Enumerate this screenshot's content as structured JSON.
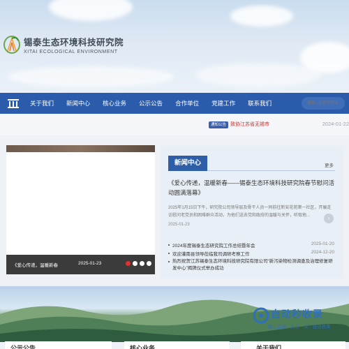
{
  "header": {
    "org_name_cn": "锡泰生态环境科技研究院",
    "org_name_en": "XITAI ECOLOGICAL ENVIRONMENT",
    "logo_icon": "leaf-logo-icon"
  },
  "nav": {
    "home_icon": "home-icon",
    "items": [
      {
        "label": "关于我们"
      },
      {
        "label": "新闻中心"
      },
      {
        "label": "核心业务"
      },
      {
        "label": "公示公告"
      },
      {
        "label": "合作单位"
      },
      {
        "label": "党建工作"
      },
      {
        "label": "联系我们"
      }
    ],
    "search_placeholder": "请输入关键字查询"
  },
  "notice": {
    "tag": "通知公告",
    "text": "致协江苏省无锡市",
    "date": "2024-01-22"
  },
  "slider": {
    "caption": "《爱心传递，温暖新春",
    "date": "2025-01-23",
    "active_color": "#e0312e"
  },
  "news": {
    "tab": "新闻中心",
    "more": "更多",
    "featured": {
      "title": "《爱心传递，温暖新春——锡泰生态环境科技研究院春节慰问活动圆满落幕》",
      "desc": "2025年1月15日下午，研究院公司领导层及骨干人员一同前往新安花苑第一社区，开展走访慰问老党员和困难群众活动，为他们送去党和政府的温暖与关怀，听取他...",
      "date": "2025-01-23"
    },
    "list": [
      {
        "title": "2024年度锡泰生态研究院工作总结暨年会",
        "date": "2025-01-20"
      },
      {
        "title": "欢迎灌南县领导莅临我司调研考察工作",
        "date": "2024-12-20"
      },
      {
        "title": "热烈祝贺江苏锡泰生态环境科技研究院有限公司“新污染物检测调查及治理修复研发中心”揭牌仪式举办成功",
        "date": ""
      }
    ]
  },
  "watermark": {
    "title": "自动秒收录",
    "sub": "路上佳铺 · 未访一次 · 自动收录"
  },
  "bottom": {
    "col1": "公示公告",
    "col2": "核心业务",
    "col3": "关于我们"
  }
}
